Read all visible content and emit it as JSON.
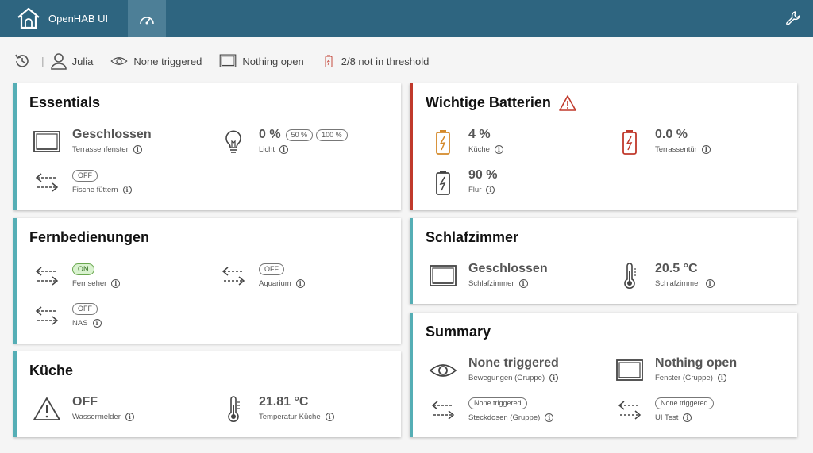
{
  "header": {
    "brand": "OpenHAB UI",
    "home_icon": "home-icon",
    "dashboard_icon": "gauge-icon",
    "settings_icon": "wrench-icon"
  },
  "statusbar": {
    "user": "Julia",
    "motion": "None triggered",
    "windows": "Nothing open",
    "batteries": "2/8 not in threshold"
  },
  "colors": {
    "accent": "#2e6580",
    "card_border": "#55aeb5",
    "alert": "#c0392b",
    "battery_low": "#d4892a"
  },
  "essentials": {
    "title": "Essentials",
    "window": {
      "value": "Geschlossen",
      "label": "Terrassenfenster"
    },
    "light": {
      "value": "0 %",
      "label": "Licht",
      "preset1": "50 %",
      "preset2": "100 %"
    },
    "fish": {
      "value": "OFF",
      "label": "Fische füttern"
    }
  },
  "batteries": {
    "title": "Wichtige Batterien",
    "kueche": {
      "value": "4 %",
      "label": "Küche"
    },
    "terrasse": {
      "value": "0.0 %",
      "label": "Terrassentür"
    },
    "flur": {
      "value": "90 %",
      "label": "Flur"
    }
  },
  "remotes": {
    "title": "Fernbedienungen",
    "tv": {
      "value": "ON",
      "label": "Fernseher"
    },
    "aquarium": {
      "value": "OFF",
      "label": "Aquarium"
    },
    "nas": {
      "value": "OFF",
      "label": "NAS"
    }
  },
  "bedroom": {
    "title": "Schlafzimmer",
    "window": {
      "value": "Geschlossen",
      "label": "Schlafzimmer"
    },
    "temp": {
      "value": "20.5 °C",
      "label": "Schlafzimmer"
    }
  },
  "kitchen": {
    "title": "Küche",
    "water": {
      "value": "OFF",
      "label": "Wassermelder"
    },
    "temp": {
      "value": "21.81 °C",
      "label": "Temperatur Küche"
    }
  },
  "summary": {
    "title": "Summary",
    "motion": {
      "value": "None triggered",
      "label": "Bewegungen (Gruppe)"
    },
    "windows": {
      "value": "Nothing open",
      "label": "Fenster (Gruppe)"
    },
    "sockets": {
      "value": "None triggered",
      "label": "Steckdosen (Gruppe)"
    },
    "uitest": {
      "value": "None triggered",
      "label": "UI Test"
    }
  }
}
